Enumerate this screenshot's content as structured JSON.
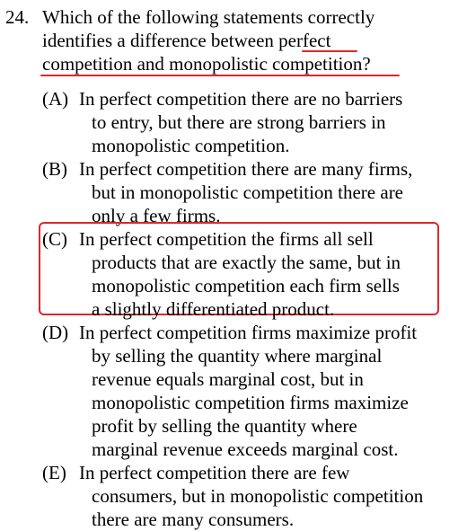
{
  "question": {
    "number": "24.",
    "lines": [
      "Which of the following statements correctly",
      "identifies a difference between perfect",
      "competition and monopolistic competition?"
    ]
  },
  "options": [
    {
      "letter": "(A)",
      "lines": [
        "In perfect competition there are no barriers",
        "to entry, but there are strong barriers in",
        "monopolistic competition."
      ]
    },
    {
      "letter": "(B)",
      "lines": [
        "In perfect competition there are many firms,",
        "but in monopolistic competition there are",
        "only a few firms."
      ]
    },
    {
      "letter": "(C)",
      "highlighted": true,
      "lines": [
        "In perfect competition the firms all sell",
        "products that are exactly the same, but in",
        "monopolistic competition each firm sells",
        "a slightly differentiated product."
      ]
    },
    {
      "letter": "(D)",
      "lines": [
        "In perfect competition firms maximize profit",
        "by selling the quantity where marginal",
        "revenue equals marginal cost, but in",
        "monopolistic competition firms maximize",
        "profit by selling the quantity where",
        "marginal revenue exceeds marginal cost."
      ]
    },
    {
      "letter": "(E)",
      "lines": [
        "In perfect competition there are few",
        "consumers, but in monopolistic competition",
        "there are many consumers."
      ]
    }
  ],
  "colors": {
    "annotation": "#e0262b",
    "text": "#000000"
  }
}
